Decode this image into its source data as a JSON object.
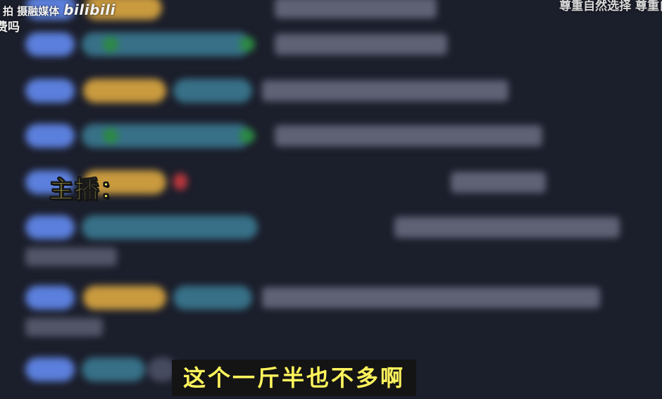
{
  "watermark": {
    "left_top": "拍 摄融媒体",
    "brand": "bilibili",
    "left_line2": "费吗",
    "right_top": "尊重自然选择  尊重自然"
  },
  "speaker_label": "主播：",
  "subtitle": "这个一斤半也不多啊",
  "colors": {
    "background": "#1b1e2b",
    "speaker": "#fff45c",
    "subtitle_text": "#fff45c",
    "subtitle_bg": "#141414",
    "wave": "#27d3c6"
  },
  "icons": {
    "waveform": "audio-waveform-icon"
  }
}
